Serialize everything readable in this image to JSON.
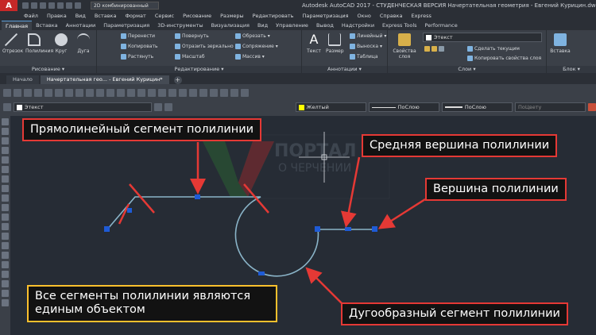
{
  "title_bar": {
    "app_logo": "A",
    "workspace": "2D комбинированный",
    "title": "Autodesk AutoCAD 2017 - СТУДЕНЧЕСКАЯ ВЕРСИЯ    Начертательная геометрия - Евгений Курицин.dwg"
  },
  "menu": [
    "Файл",
    "Правка",
    "Вид",
    "Вставка",
    "Формат",
    "Сервис",
    "Рисование",
    "Размеры",
    "Редактировать",
    "Параметризация",
    "Окно",
    "Справка",
    "Express"
  ],
  "ribbon_tabs": [
    "Главная",
    "Вставка",
    "Аннотации",
    "Параметризация",
    "3D-инструменты",
    "Визуализация",
    "Вид",
    "Управление",
    "Вывод",
    "Надстройки",
    "Express Tools",
    "Performance"
  ],
  "ribbon": {
    "draw": {
      "label": "Рисование ▾",
      "tools": [
        "Отрезок",
        "Полилиния",
        "Круг",
        "Дуга"
      ]
    },
    "modify": {
      "label": "Редактирование ▾",
      "tools": [
        "Перенести",
        "Повернуть",
        "Обрезать ▾",
        "Копировать",
        "Отразить зеркально",
        "Сопряжение ▾",
        "Растянуть",
        "Масштаб",
        "Массив ▾"
      ]
    },
    "annotation": {
      "label": "Аннотации ▾",
      "tools": [
        "Текст",
        "Размер",
        "Линейный ▾",
        "Выноска ▾",
        "Таблица"
      ]
    },
    "layers": {
      "label": "Слои ▾",
      "big_tool": "Свойства слоя",
      "layer_name": "Этекст",
      "tools": [
        "Сделать текущим",
        "Копировать свойства слоя"
      ]
    },
    "block": {
      "label": "Блок ▾",
      "big_tool": "Вставка"
    }
  },
  "doc_tabs": [
    "Начало",
    "Начертательная гео... - Евгений Курицин*"
  ],
  "properties": {
    "layer": "Этекст",
    "color": "Желтый",
    "linetype": "ПоСлою",
    "lineweight": "ПоСлою",
    "plotstyle": "ПоЦвету"
  },
  "callouts": {
    "straight_segment": "Прямолинейный сегмент полилинии",
    "middle_vertex": "Средняя вершина полилинии",
    "vertex": "Вершина полилинии",
    "single_object": "Все сегменты полилинии являются единым объектом",
    "arc_segment": "Дугообразный сегмент полилинии"
  },
  "watermark": "ПОРТАЛ О ЧЕРЧЕНИИ",
  "colors": {
    "background": "#262c35",
    "polyline": "#8ab4c8",
    "grip": "#1e5bd6",
    "arrow": "#e53935",
    "callout_red_border": "#e53935",
    "callout_yellow_border": "#fbc02d",
    "layer_color": "#ffff00"
  }
}
